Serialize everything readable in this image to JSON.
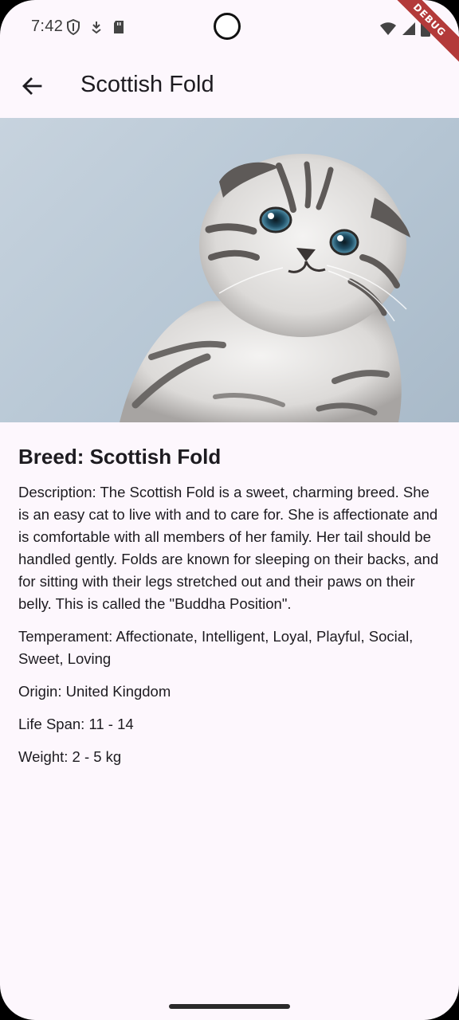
{
  "status_bar": {
    "time": "7:42",
    "left_icons": [
      "shield-icon",
      "download-icon",
      "sd-card-icon"
    ],
    "right_icons": [
      "wifi-icon",
      "signal-icon",
      "battery-icon"
    ],
    "debug_label": "DEBUG"
  },
  "app_bar": {
    "back_icon": "arrow-back-icon",
    "title": "Scottish Fold"
  },
  "hero": {
    "image_subject": "kitten-photo"
  },
  "detail": {
    "breed": "Breed: Scottish Fold",
    "description": "Description: The Scottish Fold is a sweet, charming breed. She is an easy cat to live with and to care for. She is affectionate and is comfortable with all members of her family. Her tail should be handled gently. Folds are known for sleeping on their backs, and for sitting with their legs stretched out and their paws on their belly. This is called the \"Buddha Position\".",
    "temperament": "Temperament: Affectionate, Intelligent, Loyal, Playful, Social, Sweet, Loving",
    "origin": "Origin: United Kingdom",
    "life_span": "Life Span: 11 - 14",
    "weight": "Weight: 2 - 5 kg"
  },
  "colors": {
    "background": "#fdf7fd",
    "text": "#1d1b20",
    "debug_banner": "#b33a3a"
  }
}
